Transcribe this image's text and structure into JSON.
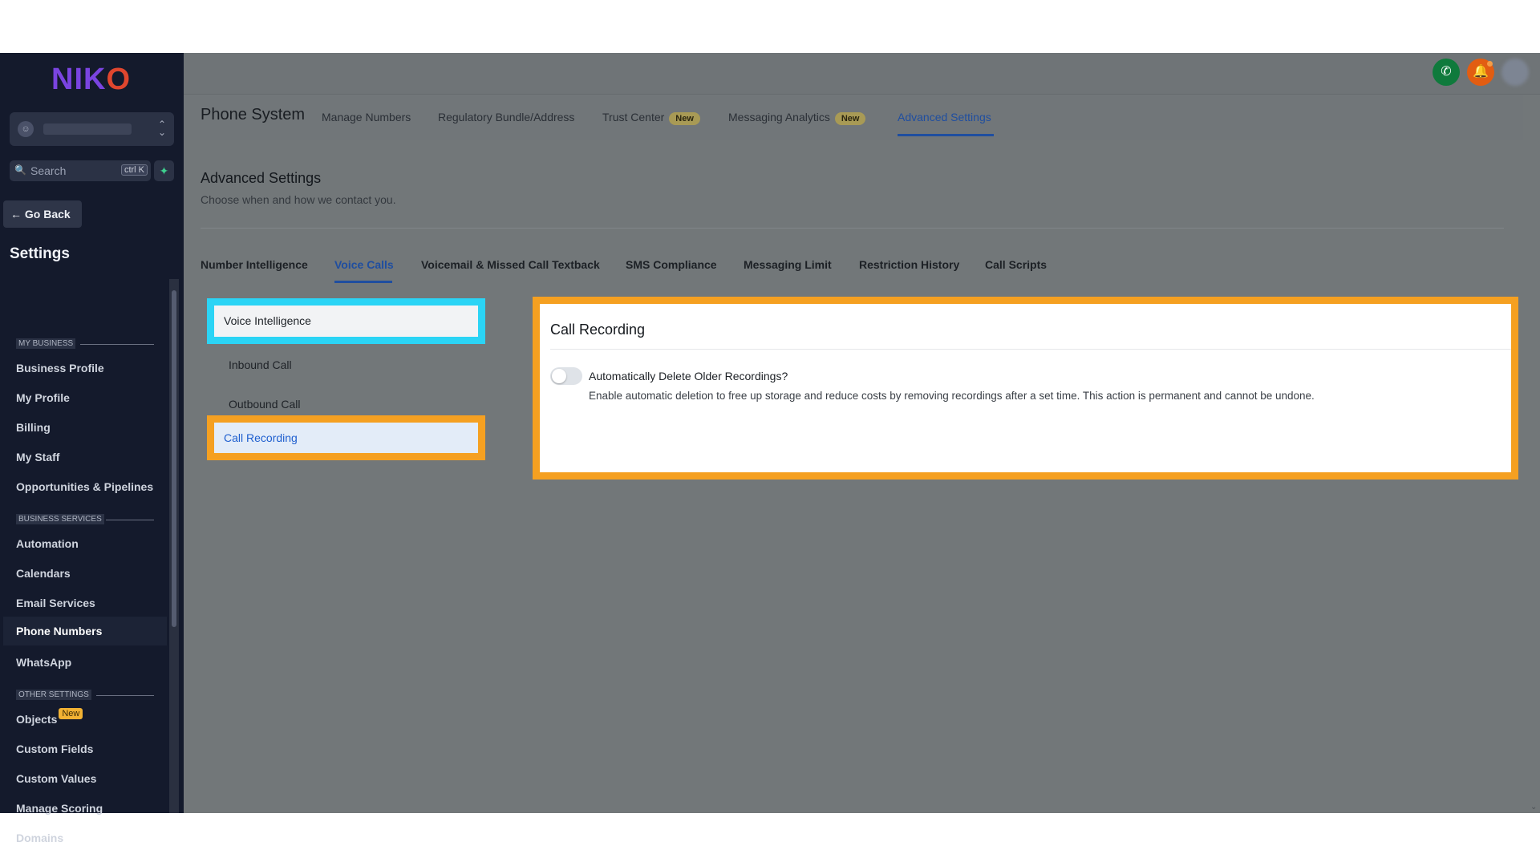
{
  "app": {
    "logo": "NIKO"
  },
  "sidebar": {
    "account_avatar": "person-icon",
    "search_placeholder": "Search",
    "search_shortcut": "ctrl K",
    "go_back": "Go Back",
    "title": "Settings",
    "sections": {
      "my_business": "MY BUSINESS",
      "business_services": "BUSINESS SERVICES",
      "other_settings": "OTHER SETTINGS"
    },
    "items": [
      {
        "label": "Business Profile"
      },
      {
        "label": "My Profile"
      },
      {
        "label": "Billing"
      },
      {
        "label": "My Staff"
      },
      {
        "label": "Opportunities & Pipelines"
      },
      {
        "label": "Automation"
      },
      {
        "label": "Calendars"
      },
      {
        "label": "Email Services"
      },
      {
        "label": "Phone Numbers",
        "active": true
      },
      {
        "label": "WhatsApp"
      },
      {
        "label": "Objects",
        "badge": "New"
      },
      {
        "label": "Custom Fields"
      },
      {
        "label": "Custom Values"
      },
      {
        "label": "Manage Scoring"
      },
      {
        "label": "Domains"
      }
    ]
  },
  "header": {
    "title": "Phone System",
    "tabs": [
      {
        "label": "Manage Numbers"
      },
      {
        "label": "Regulatory Bundle/Address"
      },
      {
        "label": "Trust Center",
        "badge": "New"
      },
      {
        "label": "Messaging Analytics",
        "badge": "New"
      },
      {
        "label": "Advanced Settings",
        "active": true
      }
    ]
  },
  "page": {
    "title": "Advanced Settings",
    "subtitle": "Choose when and how we contact you.",
    "tabs": [
      {
        "label": "Number Intelligence"
      },
      {
        "label": "Voice Calls",
        "active": true
      },
      {
        "label": "Voicemail & Missed Call Textback"
      },
      {
        "label": "SMS Compliance"
      },
      {
        "label": "Messaging Limit"
      },
      {
        "label": "Restriction History"
      },
      {
        "label": "Call Scripts"
      }
    ],
    "menu": [
      {
        "label": "Voice Intelligence"
      },
      {
        "label": "Inbound Call"
      },
      {
        "label": "Outbound Call"
      },
      {
        "label": "Call Recording",
        "active": true
      }
    ],
    "panel": {
      "title": "Call Recording",
      "toggle_label": "Automatically Delete Older Recordings?",
      "toggle_on": false,
      "toggle_description": "Enable automatic deletion to free up storage and reduce costs by removing recordings after a set time. This action is permanent and cannot be undone."
    }
  },
  "colors": {
    "accent": "#1f4ea0",
    "highlight_cyan": "#2bd4f5",
    "highlight_orange": "#f5a021",
    "sidebar_bg": "#141a2c"
  }
}
